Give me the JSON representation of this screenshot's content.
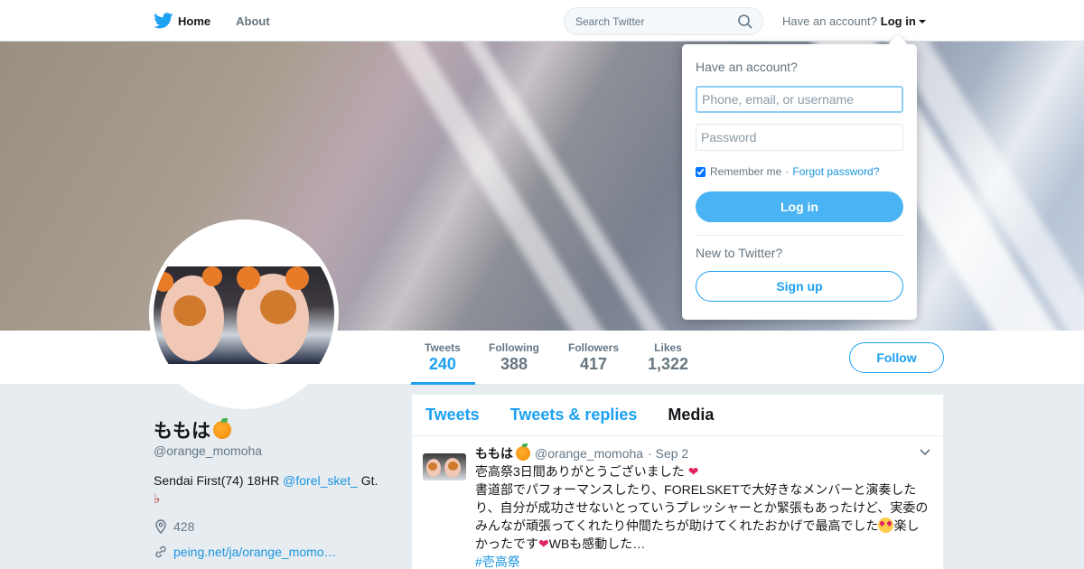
{
  "nav": {
    "home_label": "Home",
    "about_label": "About",
    "search_placeholder": "Search Twitter",
    "have_account": "Have an account?",
    "login_label": "Log in"
  },
  "profile": {
    "name": "ももは",
    "handle": "@orange_momoha",
    "bio_prefix": "Sendai First(74) 18HR ",
    "bio_mention": "@forel_sket_",
    "bio_suffix": " Gt.",
    "location": "428",
    "website": "peing.net/ja/orange_momo…"
  },
  "stats": [
    {
      "label": "Tweets",
      "value": "240"
    },
    {
      "label": "Following",
      "value": "388"
    },
    {
      "label": "Followers",
      "value": "417"
    },
    {
      "label": "Likes",
      "value": "1,322"
    }
  ],
  "follow_label": "Follow",
  "timeline": {
    "tabs": [
      "Tweets",
      "Tweets & replies",
      "Media"
    ],
    "active_tab": "Media",
    "tweet": {
      "name": "ももは",
      "handle": "@orange_momoha",
      "date": "· Sep 2",
      "line1": "壱高祭3日間ありがとうございました",
      "line2": "書道部でパフォーマンスしたり、FORELSKETで大好きなメンバーと演奏した",
      "line3": "り、自分が成功させないとっていうプレッシャーとか緊張もあったけど、実委の",
      "line4a": "みんなが頑張ってくれたり仲間たちが助けてくれたおかげで最高でした",
      "line4b": "楽し",
      "line5a": "かったです",
      "line5b": "WBも感動した…",
      "hashtag": "#壱高祭"
    }
  },
  "login_dropdown": {
    "title": "Have an account?",
    "username_placeholder": "Phone, email, or username",
    "password_placeholder": "Password",
    "remember_label": "Remember me",
    "remember_checked": true,
    "separator": "·",
    "forgot_label": "Forgot password?",
    "login_button": "Log in",
    "new_label": "New to Twitter?",
    "signup_button": "Sign up"
  },
  "colors": {
    "accent": "#1da1f2",
    "login_button_bg": "#4ab3f4",
    "page_bg": "#e6ecf0"
  }
}
